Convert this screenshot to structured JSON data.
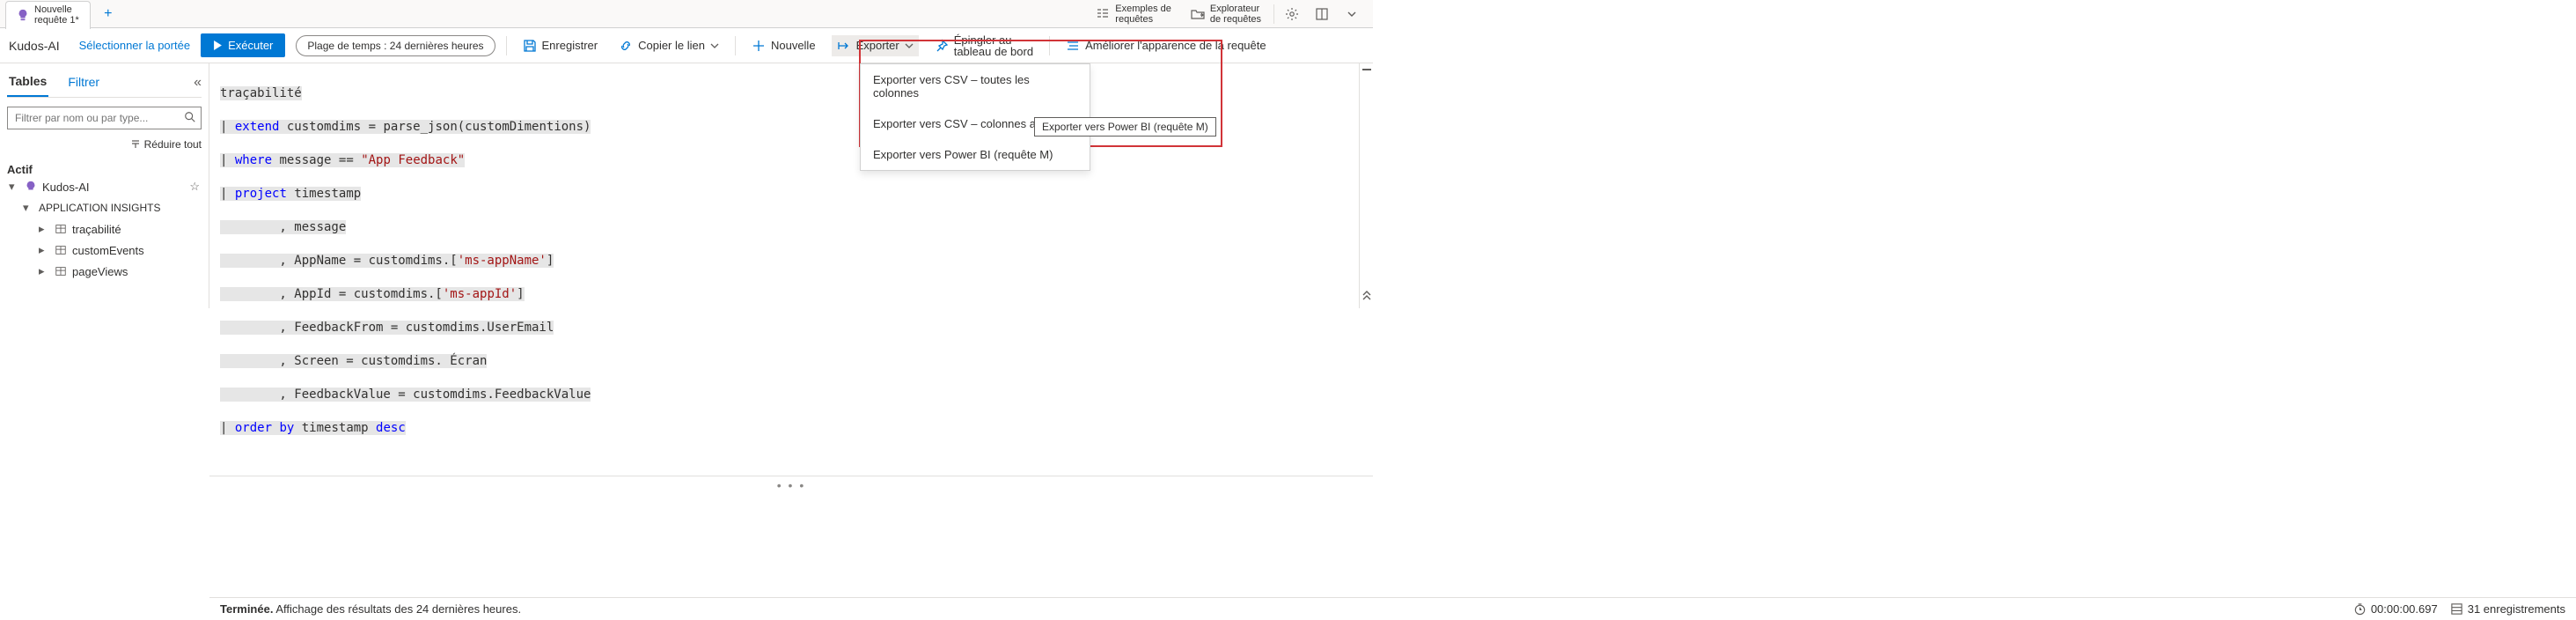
{
  "tabs": {
    "query_line1": "Nouvelle",
    "query_line2": "requête 1*"
  },
  "top_right": {
    "examples_line1": "Exemples de",
    "examples_line2": "requêtes",
    "explorer_line1": "Explorateur",
    "explorer_line2": "de requêtes"
  },
  "scope": {
    "name": "Kudos-AI",
    "select_scope": "Sélectionner la portée"
  },
  "toolbar": {
    "run": "Exécuter",
    "time_range": "Plage de temps : 24 dernières heures",
    "save": "Enregistrer",
    "copy_link": "Copier le lien",
    "new": "Nouvelle",
    "export": "Exporter",
    "pin_line1": "Épingler au",
    "pin_line2": "tableau de bord",
    "format": "Améliorer l'apparence de la requête"
  },
  "export_menu": {
    "csv_all": "Exporter vers CSV – toutes les colonnes",
    "csv_disp": "Exporter vers CSV – colonnes affichées",
    "powerbi": "Exporter vers Power BI (requête M)"
  },
  "tooltip": "Exporter vers Power BI (requête M)",
  "left": {
    "tab_tables": "Tables",
    "tab_filter": "Filtrer",
    "filter_placeholder": "Filtrer par nom ou par type...",
    "collapse_all": "Réduire tout",
    "section_active": "Actif",
    "root": "Kudos-AI",
    "group": "APPLICATION INSIGHTS",
    "t1": "traçabilité",
    "t2": "customEvents",
    "t3": "pageViews"
  },
  "editor": {
    "l1": "traçabilité",
    "l2_pipe": "|",
    "l2_kw": "extend",
    "l2_rest": " customdims = parse_json(customDimentions)",
    "l3_pipe": "|",
    "l3_kw": "where",
    "l3_a": " message == ",
    "l3_str": "\"App Feedback\"",
    "l4_pipe": "|",
    "l4_kw": "project",
    "l4_rest": " timestamp",
    "l5": "        , message",
    "l6a": "        , AppName = customdims.[",
    "l6s": "'ms-appName'",
    "l6b": "]",
    "l7a": "        , AppId = customdims.[",
    "l7s": "'ms-appId'",
    "l7b": "]",
    "l8": "        , FeedbackFrom = customdims.UserEmail",
    "l9": "        , Screen = customdims. Écran",
    "l10": "        , FeedbackValue = customdims.FeedbackValue",
    "l11_pipe": "|",
    "l11_kw1": "order",
    "l11_kw2": "by",
    "l11_rest": " timestamp ",
    "l11_kw3": "desc"
  },
  "status": {
    "done": "Terminée.",
    "desc": " Affichage des résultats des 24 dernières heures.",
    "time": "00:00:00.697",
    "records": "31 enregistrements"
  }
}
